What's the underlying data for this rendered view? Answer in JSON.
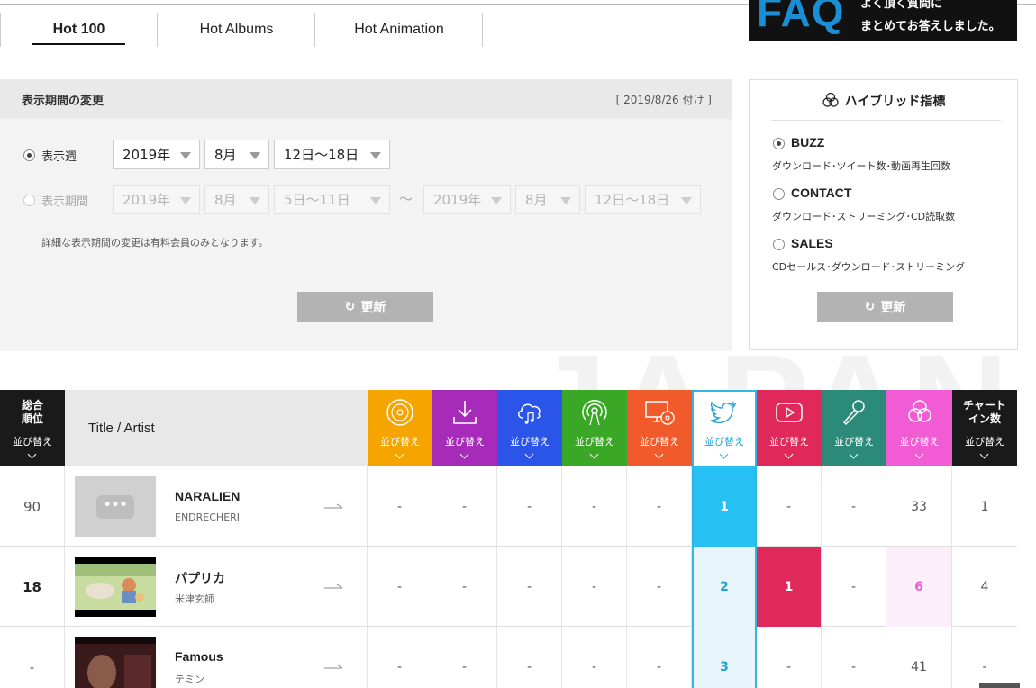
{
  "tabs": [
    {
      "label": "Hot 100"
    },
    {
      "label": "Hot Albums"
    },
    {
      "label": "Hot Animation"
    }
  ],
  "faq": {
    "big": "FAQ",
    "line1": "よく頂く質問に",
    "line2": "まとめてお答えしました。"
  },
  "period": {
    "title": "表示期間の変更",
    "date": "[ 2019/8/26 付け ]",
    "week_label": "表示週",
    "week": {
      "year": "2019年",
      "month": "8月",
      "days": "12日〜18日"
    },
    "range_label": "表示期間",
    "range_from": {
      "year": "2019年",
      "month": "8月",
      "days": "5日〜11日"
    },
    "range_tilde": "〜",
    "range_to": {
      "year": "2019年",
      "month": "8月",
      "days": "12日〜18日"
    },
    "note": "詳細な表示期間の変更は有料会員のみとなります。",
    "update_label": "更新"
  },
  "hybrid": {
    "title": "ハイブリッド指標",
    "options": [
      {
        "label": "BUZZ",
        "desc": "ダウンロード･ツイート数･動画再生回数",
        "selected": true
      },
      {
        "label": "CONTACT",
        "desc": "ダウンロード･ストリーミング･CD読取数",
        "selected": false
      },
      {
        "label": "SALES",
        "desc": "CDセールス･ダウンロード･ストリーミング",
        "selected": false
      }
    ],
    "update_label": "更新"
  },
  "watermark": "JAPAN",
  "table": {
    "rank_header": "総合\n順位",
    "rank_header_l1": "総合",
    "rank_header_l2": "順位",
    "title_header": "Title / Artist",
    "chartin_header_l1": "チャート",
    "chartin_header_l2": "イン数",
    "sort_label": "並び替え",
    "metric_columns": [
      {
        "name": "cd-sales",
        "icon": "cd-icon",
        "color": "#f6a400"
      },
      {
        "name": "download",
        "icon": "download-icon",
        "color": "#a52bb8"
      },
      {
        "name": "streaming",
        "icon": "cloud-music-icon",
        "color": "#2b55e8"
      },
      {
        "name": "radio",
        "icon": "broadcast-icon",
        "color": "#3aa826"
      },
      {
        "name": "cd-lookup",
        "icon": "monitor-disc-icon",
        "color": "#f15a2a"
      },
      {
        "name": "twitter",
        "icon": "twitter-bird-icon",
        "color": "#1ea5d8"
      },
      {
        "name": "youtube",
        "icon": "youtube-play-icon",
        "color": "#e0285a"
      },
      {
        "name": "karaoke",
        "icon": "microphone-icon",
        "color": "#2c8a78"
      },
      {
        "name": "hybrid",
        "icon": "hybrid-circles-icon",
        "color": "#f15bd3"
      }
    ],
    "rows": [
      {
        "rank": "90",
        "rank_bold": false,
        "title": "NARALIEN",
        "artist": "ENDRECHERI",
        "thumb": "placeholder",
        "metrics": [
          "-",
          "-",
          "-",
          "-",
          "-",
          "1",
          "-",
          "-",
          "33"
        ],
        "chart_in": "1"
      },
      {
        "rank": "18",
        "rank_bold": true,
        "title": "パプリカ",
        "artist": "米津玄師",
        "thumb": "illustration",
        "metrics": [
          "-",
          "-",
          "-",
          "-",
          "-",
          "2",
          "1",
          "-",
          "6"
        ],
        "chart_in": "4"
      },
      {
        "rank": "-",
        "rank_bold": false,
        "title": "Famous",
        "artist": "テミン",
        "thumb": "photo",
        "metrics": [
          "-",
          "-",
          "-",
          "-",
          "-",
          "3",
          "-",
          "-",
          "41"
        ],
        "chart_in": "-"
      }
    ]
  }
}
